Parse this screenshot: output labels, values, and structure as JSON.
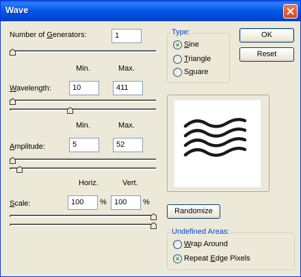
{
  "window": {
    "title": "Wave"
  },
  "generators": {
    "label": "Number of Generators:",
    "mnemonic": "G",
    "value": "1",
    "level": 0
  },
  "columns": {
    "min": "Min.",
    "max": "Max.",
    "horiz": "Horiz.",
    "vert": "Vert."
  },
  "wavelength": {
    "label": "Wavelength:",
    "mnemonic": "W",
    "min": "10",
    "max": "411",
    "min_level": 0.0,
    "max_level": 0.41
  },
  "amplitude": {
    "label": "Amplitude:",
    "mnemonic": "A",
    "min": "5",
    "max": "52",
    "min_level": 0.0,
    "max_level": 0.05
  },
  "scale": {
    "label": "Scale:",
    "mnemonic": "S",
    "horiz": "100",
    "vert": "100",
    "unit": "%",
    "horiz_level": 1.0,
    "vert_level": 1.0
  },
  "type": {
    "legend": "Type:",
    "options": [
      {
        "label": "Sine",
        "mnemonic": "S",
        "selected": true
      },
      {
        "label": "Triangle",
        "mnemonic": "T",
        "selected": false
      },
      {
        "label": "Square",
        "mnemonic": "q",
        "selected": false
      }
    ]
  },
  "buttons": {
    "ok": "OK",
    "reset": "Reset",
    "randomize": "Randomize"
  },
  "undefined_areas": {
    "legend": "Undefined Areas:",
    "options": [
      {
        "label": "Wrap Around",
        "mnemonic": "W",
        "selected": false
      },
      {
        "label": "Repeat Edge Pixels",
        "mnemonic": "E",
        "selected": true
      }
    ]
  },
  "colors": {
    "title_bar": "#0058e6",
    "group_label": "#0046d5",
    "dialog_bg": "#ece9d8"
  }
}
